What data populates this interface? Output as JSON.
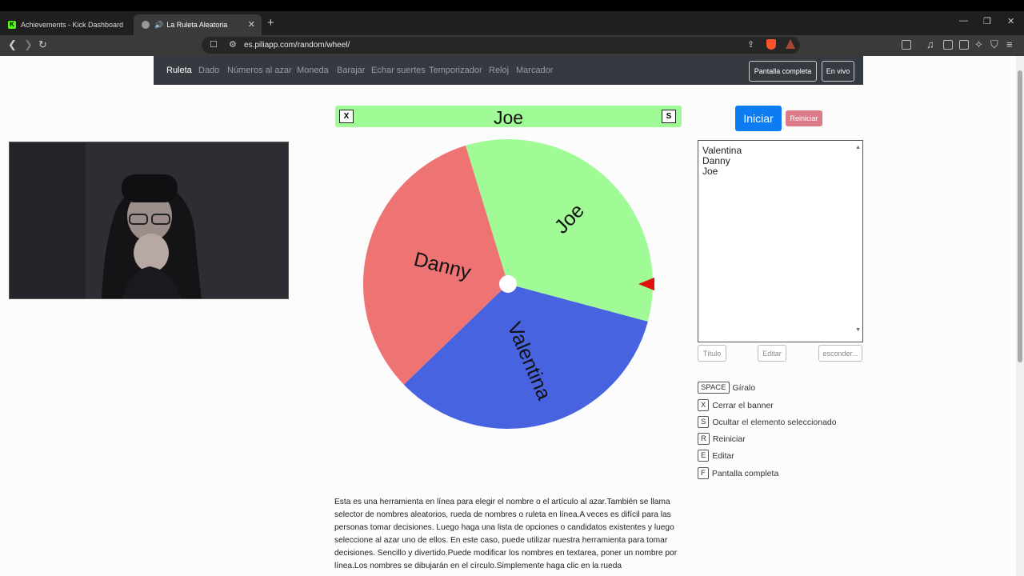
{
  "browser": {
    "tabs": [
      {
        "title": "Achievements - Kick Dashboard"
      },
      {
        "title": "La Ruleta Aleatoria"
      }
    ],
    "url": "es.piliapp.com/random/wheel/"
  },
  "site_nav": {
    "links": [
      "Ruleta",
      "Dado",
      "Números al azar",
      "Moneda",
      "Barajar",
      "Echar suertes",
      "Temporizador",
      "Reloj",
      "Marcador"
    ],
    "fullscreen_label": "Pantalla completa",
    "live_label": "En vivo"
  },
  "banner": {
    "close_key": "X",
    "hide_key": "S",
    "selected_name": "Joe"
  },
  "wheel": {
    "segments": [
      {
        "label": "Valentina",
        "color": "#4863e0"
      },
      {
        "label": "Danny",
        "color": "#ee7474"
      },
      {
        "label": "Joe",
        "color": "#a0fa96"
      }
    ],
    "pointer_color": "#e01010"
  },
  "controls": {
    "start_label": "Iniciar",
    "reset_label": "Reiniciar"
  },
  "names": [
    "Valentina",
    "Danny",
    "Joe"
  ],
  "list_buttons": {
    "title": "Título",
    "edit": "Editar",
    "hide": "esconder..."
  },
  "shortcuts": [
    {
      "key": "SPACE",
      "label": "Gíralo"
    },
    {
      "key": "X",
      "label": "Cerrar el banner"
    },
    {
      "key": "S",
      "label": "Ocultar el elemento seleccionado"
    },
    {
      "key": "R",
      "label": "Reiniciar"
    },
    {
      "key": "E",
      "label": "Editar"
    },
    {
      "key": "F",
      "label": "Pantalla completa"
    }
  ],
  "description": "Esta es una herramienta en línea para elegir el nombre o el artículo al azar.También se llama selector de nombres aleatorios, rueda de nombres o ruleta en línea.A veces es difícil para las personas tomar decisiones. Luego haga una lista de opciones o candidatos existentes y luego seleccione al azar uno de ellos. En este caso, puede utilizar nuestra herramienta para tomar decisiones. Sencillo y divertido.Puede modificar los nombres en textarea, poner un nombre por línea.Los nombres se dibujarán en el círculo.Simplemente haga clic en la rueda"
}
